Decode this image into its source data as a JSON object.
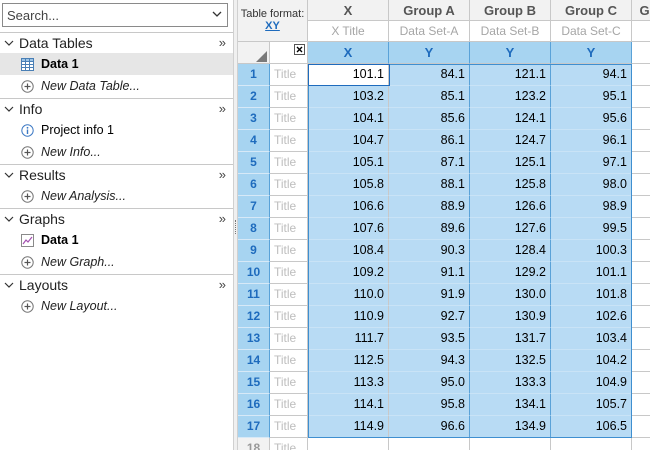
{
  "search": {
    "placeholder": "Search..."
  },
  "navigator": {
    "sections": [
      {
        "title": "Data Tables",
        "items": [
          {
            "label": "Data 1",
            "icon": "data-table-icon",
            "selected": true,
            "style": "bold"
          },
          {
            "label": "New Data Table...",
            "icon": "add-circle-icon",
            "style": "italic"
          }
        ]
      },
      {
        "title": "Info",
        "items": [
          {
            "label": "Project info 1",
            "icon": "info-icon",
            "style": "normal"
          },
          {
            "label": "New Info...",
            "icon": "add-circle-icon",
            "style": "italic"
          }
        ]
      },
      {
        "title": "Results",
        "items": [
          {
            "label": "New Analysis...",
            "icon": "add-circle-icon",
            "style": "italic"
          }
        ]
      },
      {
        "title": "Graphs",
        "items": [
          {
            "label": "Data 1",
            "icon": "graph-icon",
            "style": "bold"
          },
          {
            "label": "New Graph...",
            "icon": "add-circle-icon",
            "style": "italic"
          }
        ]
      },
      {
        "title": "Layouts",
        "items": [
          {
            "label": "New Layout...",
            "icon": "add-circle-icon",
            "style": "italic"
          }
        ]
      }
    ],
    "more_glyph": "»"
  },
  "sheet": {
    "table_format_label": "Table format:",
    "table_format_value": "XY",
    "columns": [
      {
        "name": "X",
        "title": "X Title",
        "type": "X"
      },
      {
        "name": "Group A",
        "title": "Data Set-A",
        "type": "Y"
      },
      {
        "name": "Group B",
        "title": "Data Set-B",
        "type": "Y"
      },
      {
        "name": "Group C",
        "title": "Data Set-C",
        "type": "Y"
      },
      {
        "name": "G",
        "title": "",
        "type": ""
      }
    ],
    "row_title_placeholder": "Title",
    "rows": [
      {
        "n": "1",
        "x": "101.1",
        "a": "84.1",
        "b": "121.1",
        "c": "94.1"
      },
      {
        "n": "2",
        "x": "103.2",
        "a": "85.1",
        "b": "123.2",
        "c": "95.1"
      },
      {
        "n": "3",
        "x": "104.1",
        "a": "85.6",
        "b": "124.1",
        "c": "95.6"
      },
      {
        "n": "4",
        "x": "104.7",
        "a": "86.1",
        "b": "124.7",
        "c": "96.1"
      },
      {
        "n": "5",
        "x": "105.1",
        "a": "87.1",
        "b": "125.1",
        "c": "97.1"
      },
      {
        "n": "6",
        "x": "105.8",
        "a": "88.1",
        "b": "125.8",
        "c": "98.0"
      },
      {
        "n": "7",
        "x": "106.6",
        "a": "88.9",
        "b": "126.6",
        "c": "98.9"
      },
      {
        "n": "8",
        "x": "107.6",
        "a": "89.6",
        "b": "127.6",
        "c": "99.5"
      },
      {
        "n": "9",
        "x": "108.4",
        "a": "90.3",
        "b": "128.4",
        "c": "100.3"
      },
      {
        "n": "10",
        "x": "109.2",
        "a": "91.1",
        "b": "129.2",
        "c": "101.1"
      },
      {
        "n": "11",
        "x": "110.0",
        "a": "91.9",
        "b": "130.0",
        "c": "101.8"
      },
      {
        "n": "12",
        "x": "110.9",
        "a": "92.7",
        "b": "130.9",
        "c": "102.6"
      },
      {
        "n": "13",
        "x": "111.7",
        "a": "93.5",
        "b": "131.7",
        "c": "103.4"
      },
      {
        "n": "14",
        "x": "112.5",
        "a": "94.3",
        "b": "132.5",
        "c": "104.2"
      },
      {
        "n": "15",
        "x": "113.3",
        "a": "95.0",
        "b": "133.3",
        "c": "104.9"
      },
      {
        "n": "16",
        "x": "114.1",
        "a": "95.8",
        "b": "134.1",
        "c": "105.7"
      },
      {
        "n": "17",
        "x": "114.9",
        "a": "96.6",
        "b": "134.9",
        "c": "106.5"
      },
      {
        "n": "18",
        "x": "",
        "a": "",
        "b": "",
        "c": ""
      }
    ]
  },
  "colors": {
    "selection": "#b8dbf4",
    "header_accent": "#a7d4f1",
    "accent_text": "#1e6bbd"
  }
}
